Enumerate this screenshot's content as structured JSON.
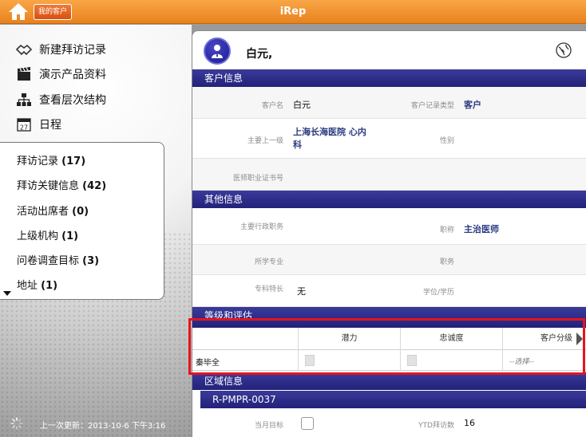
{
  "topbar": {
    "my_customers_label": "我的客户",
    "title": "iRep"
  },
  "nav": [
    {
      "label": "新建拜访记录",
      "icon": "handshake-icon"
    },
    {
      "label": "演示产品资料",
      "icon": "clapperboard-icon"
    },
    {
      "label": "查看层次结构",
      "icon": "hierarchy-icon"
    },
    {
      "label": "日程",
      "icon": "calendar-icon",
      "day": "27"
    }
  ],
  "related": [
    {
      "label": "拜访记录",
      "count": "(17)"
    },
    {
      "label": "拜访关键信息",
      "count": "(42)"
    },
    {
      "label": "活动出席者",
      "count": "(0)"
    },
    {
      "label": "上级机构",
      "count": "(1)"
    },
    {
      "label": "问卷调查目标",
      "count": "(3)"
    },
    {
      "label": "地址",
      "count": "(1)"
    }
  ],
  "last_update": "上一次更新：2013-10-6 下午3:16",
  "customer": {
    "name": "白元,"
  },
  "sections": {
    "customer_info": "客户信息",
    "other_info": "其他信息",
    "rating": "等级和评估",
    "region": "区域信息"
  },
  "customer_info": {
    "name_label": "客户名",
    "name_value": "白元",
    "type_label": "客户记录类型",
    "type_value": "客户",
    "parent_label": "主要上一级",
    "parent_value_line1": "上海长海医院 心内",
    "parent_value_line2": "科",
    "gender_label": "性别",
    "license_label": "医师职业证书号"
  },
  "other_info": {
    "admin_label": "主要行政职务",
    "title_label": "职称",
    "title_value": "主治医师",
    "major_label": "所学专业",
    "duty_label": "职务",
    "specialty_label": "专科特长",
    "specialty_value": "无",
    "degree_label": "学位/学历"
  },
  "rating": {
    "col_potential": "潜力",
    "col_loyalty": "忠诚度",
    "col_segment": "客户分级",
    "row_name": "秦毕全",
    "segment_placeholder": "--选择--"
  },
  "region": {
    "code": "R-PMPR-0037",
    "monthly_target_label": "当月目标",
    "ytd_label": "YTD拜访数",
    "ytd_value": "16"
  },
  "colors": {
    "topbar": "#f39a3a",
    "section": "#2a2a86",
    "highlight": "#e8121c",
    "value_blue": "#2a3a80"
  }
}
